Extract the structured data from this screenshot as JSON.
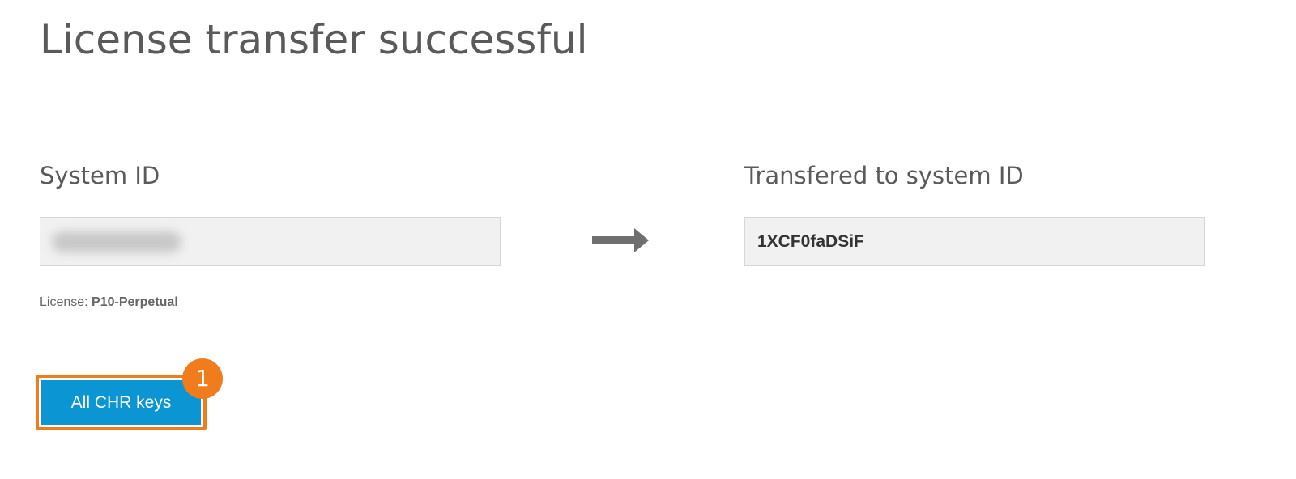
{
  "page": {
    "title": "License transfer successful"
  },
  "source": {
    "label": "System ID",
    "license_prefix": "License: ",
    "license_value": "P10-Perpetual"
  },
  "target": {
    "label": "Transfered to system ID",
    "system_id": "1XCF0faDSiF"
  },
  "actions": {
    "all_keys_label": "All CHR keys",
    "step_number": "1"
  },
  "icons": {
    "transfer": "arrow-right-icon"
  },
  "colors": {
    "button": "#0b96d3",
    "highlight": "#f07c1b",
    "field_bg": "#f1f1f1",
    "text": "#5a5a5a"
  }
}
